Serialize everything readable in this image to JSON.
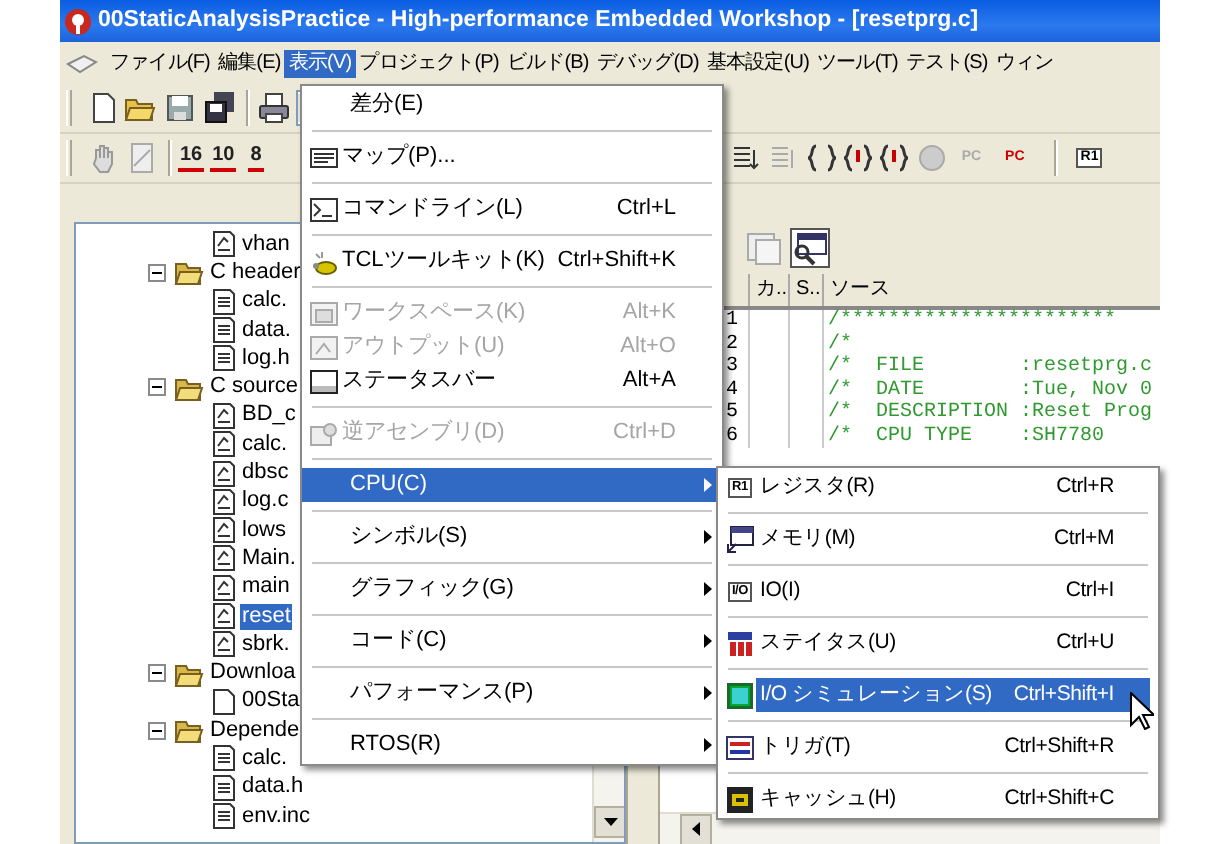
{
  "window": {
    "title": "00StaticAnalysisPractice - High-performance Embedded Workshop - [resetprg.c]"
  },
  "menu_bar": [
    {
      "label": "ファイル(F)",
      "selected": false
    },
    {
      "label": "編集(E)",
      "selected": false
    },
    {
      "label": "表示(V)",
      "selected": true
    },
    {
      "label": "プロジェクト(P)",
      "selected": false
    },
    {
      "label": "ビルド(B)",
      "selected": false
    },
    {
      "label": "デバッグ(D)",
      "selected": false
    },
    {
      "label": "基本設定(U)",
      "selected": false
    },
    {
      "label": "ツール(T)",
      "selected": false
    },
    {
      "label": "テスト(S)",
      "selected": false
    },
    {
      "label": "ウィン",
      "selected": false
    }
  ],
  "toolbar_2": {
    "radix_buttons": [
      "16",
      "10",
      "8"
    ],
    "pc_buttons": [
      "PC",
      "PC"
    ],
    "register_button": "R1"
  },
  "tree": {
    "items": [
      {
        "kind": "source",
        "label": "vhan",
        "selected": false
      },
      {
        "kind": "folder",
        "label": "C header",
        "expanded": true,
        "selected": false,
        "children": [
          {
            "kind": "header",
            "label": "calc.",
            "selected": false
          },
          {
            "kind": "header",
            "label": "data.",
            "selected": false
          },
          {
            "kind": "header",
            "label": "log.h",
            "selected": false
          }
        ]
      },
      {
        "kind": "folder",
        "label": "C source",
        "expanded": true,
        "selected": false,
        "children": [
          {
            "kind": "source",
            "label": "BD_c",
            "selected": false
          },
          {
            "kind": "source",
            "label": "calc.",
            "selected": false
          },
          {
            "kind": "source",
            "label": "dbsc",
            "selected": false
          },
          {
            "kind": "source",
            "label": "log.c",
            "selected": false
          },
          {
            "kind": "source",
            "label": "lows",
            "selected": false
          },
          {
            "kind": "source",
            "label": "Main.",
            "selected": false
          },
          {
            "kind": "source",
            "label": "main",
            "selected": false
          },
          {
            "kind": "source",
            "label": "reset",
            "selected": true
          },
          {
            "kind": "source",
            "label": "sbrk.",
            "selected": false
          }
        ]
      },
      {
        "kind": "folder",
        "label": "Downloa",
        "expanded": true,
        "selected": false,
        "children": [
          {
            "kind": "file",
            "label": "00Sta",
            "selected": false
          }
        ]
      },
      {
        "kind": "folder",
        "label": "Depende",
        "expanded": true,
        "selected": false,
        "children": [
          {
            "kind": "header",
            "label": "calc.",
            "selected": false
          },
          {
            "kind": "header",
            "label": "data.h",
            "selected": false
          },
          {
            "kind": "header",
            "label": "env.inc",
            "selected": false
          }
        ]
      }
    ]
  },
  "editor": {
    "columns": [
      "カ..",
      "S..",
      "ソース"
    ],
    "lines": [
      {
        "number": "1",
        "text": "/***********************"
      },
      {
        "number": "2",
        "text": "/*"
      },
      {
        "number": "3",
        "text": "/*  FILE        :resetprg.c"
      },
      {
        "number": "4",
        "text": "/*  DATE        :Tue, Nov 0"
      },
      {
        "number": "5",
        "text": "/*  DESCRIPTION :Reset Prog"
      },
      {
        "number": "6",
        "text": "/*  CPU TYPE    :SH7780"
      }
    ]
  },
  "view_menu": {
    "items": [
      {
        "kind": "item",
        "label": "差分(E)",
        "disabled": false,
        "selected": false
      },
      {
        "kind": "separator"
      },
      {
        "kind": "item",
        "label": "マップ(P)...",
        "disabled": false,
        "selected": false
      },
      {
        "kind": "separator"
      },
      {
        "kind": "item",
        "label": "コマンドライン(L)",
        "shortcut": "Ctrl+L",
        "disabled": false,
        "selected": false
      },
      {
        "kind": "separator"
      },
      {
        "kind": "item",
        "label": "TCLツールキット(K)",
        "shortcut": "Ctrl+Shift+K",
        "disabled": false,
        "selected": false
      },
      {
        "kind": "separator"
      },
      {
        "kind": "item",
        "label": "ワークスペース(K)",
        "shortcut": "Alt+K",
        "disabled": true,
        "selected": false
      },
      {
        "kind": "item",
        "label": "アウトプット(U)",
        "shortcut": "Alt+O",
        "disabled": true,
        "selected": false
      },
      {
        "kind": "item",
        "label": "ステータスバー",
        "shortcut": "Alt+A",
        "disabled": false,
        "selected": false
      },
      {
        "kind": "separator"
      },
      {
        "kind": "item",
        "label": "逆アセンブリ(D)",
        "shortcut": "Ctrl+D",
        "disabled": true,
        "selected": false
      },
      {
        "kind": "separator"
      },
      {
        "kind": "submenu",
        "label": "CPU(C)",
        "disabled": false,
        "selected": true
      },
      {
        "kind": "separator"
      },
      {
        "kind": "submenu",
        "label": "シンボル(S)",
        "disabled": false,
        "selected": false
      },
      {
        "kind": "separator"
      },
      {
        "kind": "submenu",
        "label": "グラフィック(G)",
        "disabled": false,
        "selected": false
      },
      {
        "kind": "separator"
      },
      {
        "kind": "submenu",
        "label": "コード(C)",
        "disabled": false,
        "selected": false
      },
      {
        "kind": "separator"
      },
      {
        "kind": "submenu",
        "label": "パフォーマンス(P)",
        "disabled": false,
        "selected": false
      },
      {
        "kind": "separator"
      },
      {
        "kind": "submenu",
        "label": "RTOS(R)",
        "disabled": false,
        "selected": false
      }
    ]
  },
  "cpu_submenu": {
    "items": [
      {
        "kind": "item",
        "label": "レジスタ(R)",
        "icon_text": "R1",
        "shortcut": "Ctrl+R",
        "disabled": false,
        "selected": false
      },
      {
        "kind": "separator"
      },
      {
        "kind": "item",
        "label": "メモリ(M)",
        "shortcut": "Ctrl+M",
        "disabled": false,
        "selected": false
      },
      {
        "kind": "separator"
      },
      {
        "kind": "item",
        "label": "IO(I)",
        "icon_text": "I/O",
        "shortcut": "Ctrl+I",
        "disabled": false,
        "selected": false
      },
      {
        "kind": "separator"
      },
      {
        "kind": "item",
        "label": "ステイタス(U)",
        "shortcut": "Ctrl+U",
        "disabled": false,
        "selected": false
      },
      {
        "kind": "separator"
      },
      {
        "kind": "item",
        "label": "I/O シミュレーション(S)",
        "shortcut": "Ctrl+Shift+I",
        "disabled": false,
        "selected": true
      },
      {
        "kind": "separator"
      },
      {
        "kind": "item",
        "label": "トリガ(T)",
        "shortcut": "Ctrl+Shift+R",
        "disabled": false,
        "selected": false
      },
      {
        "kind": "separator"
      },
      {
        "kind": "item",
        "label": "キャッシュ(H)",
        "shortcut": "Ctrl+Shift+C",
        "disabled": false,
        "selected": false
      }
    ]
  }
}
